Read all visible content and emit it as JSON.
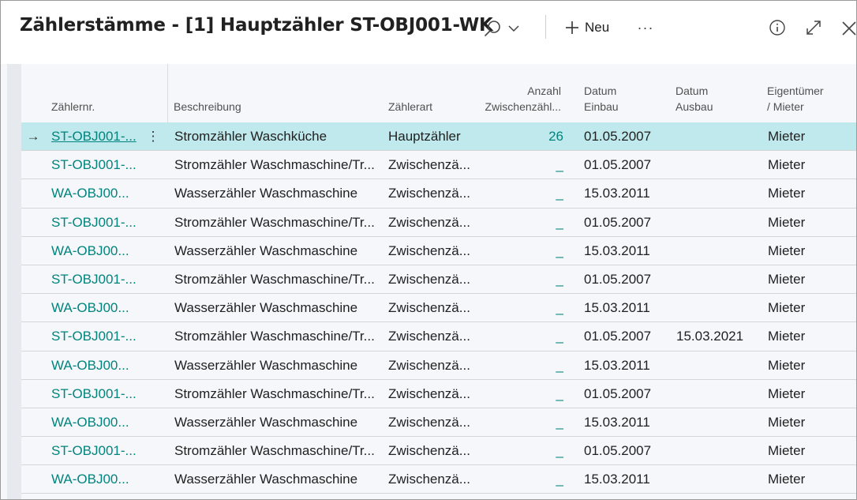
{
  "header": {
    "title": "Zählerstämme - [1] Hauptzähler ST-OBJ001-WK",
    "new_label": "Neu",
    "more_label": "···",
    "icons": {
      "search": "search-icon",
      "chevron": "chevron-down-icon",
      "plus": "plus-icon",
      "info": "info-icon",
      "expand": "expand-icon",
      "close": "close-icon"
    }
  },
  "columns": {
    "nr": "Zählernr.",
    "beschreibung": "Beschreibung",
    "art": "Zählerart",
    "anzahl_1": "Anzahl",
    "anzahl_2": "Zwischenzähl...",
    "einbau_1": "Datum",
    "einbau_2": "Einbau",
    "ausbau_1": "Datum",
    "ausbau_2": "Ausbau",
    "eig_1": "Eigentümer",
    "eig_2": "/ Mieter"
  },
  "selected_arrow": "→",
  "row_menu": "⋮",
  "rows": [
    {
      "nr": "ST-OBJ001-...",
      "beschreibung": "Stromzähler Waschküche",
      "art": "Hauptzähler",
      "anzahl": "26",
      "einbau": "01.05.2007",
      "ausbau": "",
      "eig": "Mieter"
    },
    {
      "nr": "ST-OBJ001-...",
      "beschreibung": "Stromzähler Waschmaschine/Tr...",
      "art": "Zwischenzä...",
      "anzahl": "_",
      "einbau": "01.05.2007",
      "ausbau": "",
      "eig": "Mieter"
    },
    {
      "nr": "WA-OBJ00...",
      "beschreibung": "Wasserzähler Waschmaschine",
      "art": "Zwischenzä...",
      "anzahl": "_",
      "einbau": "15.03.2011",
      "ausbau": "",
      "eig": "Mieter"
    },
    {
      "nr": "ST-OBJ001-...",
      "beschreibung": "Stromzähler Waschmaschine/Tr...",
      "art": "Zwischenzä...",
      "anzahl": "_",
      "einbau": "01.05.2007",
      "ausbau": "",
      "eig": "Mieter"
    },
    {
      "nr": "WA-OBJ00...",
      "beschreibung": "Wasserzähler Waschmaschine",
      "art": "Zwischenzä...",
      "anzahl": "_",
      "einbau": "15.03.2011",
      "ausbau": "",
      "eig": "Mieter"
    },
    {
      "nr": "ST-OBJ001-...",
      "beschreibung": "Stromzähler Waschmaschine/Tr...",
      "art": "Zwischenzä...",
      "anzahl": "_",
      "einbau": "01.05.2007",
      "ausbau": "",
      "eig": "Mieter"
    },
    {
      "nr": "WA-OBJ00...",
      "beschreibung": "Wasserzähler Waschmaschine",
      "art": "Zwischenzä...",
      "anzahl": "_",
      "einbau": "15.03.2011",
      "ausbau": "",
      "eig": "Mieter"
    },
    {
      "nr": "ST-OBJ001-...",
      "beschreibung": "Stromzähler Waschmaschine/Tr...",
      "art": "Zwischenzä...",
      "anzahl": "_",
      "einbau": "01.05.2007",
      "ausbau": "15.03.2021",
      "eig": "Mieter"
    },
    {
      "nr": "WA-OBJ00...",
      "beschreibung": "Wasserzähler Waschmaschine",
      "art": "Zwischenzä...",
      "anzahl": "_",
      "einbau": "15.03.2011",
      "ausbau": "",
      "eig": "Mieter"
    },
    {
      "nr": "ST-OBJ001-...",
      "beschreibung": "Stromzähler Waschmaschine/Tr...",
      "art": "Zwischenzä...",
      "anzahl": "_",
      "einbau": "01.05.2007",
      "ausbau": "",
      "eig": "Mieter"
    },
    {
      "nr": "WA-OBJ00...",
      "beschreibung": "Wasserzähler Waschmaschine",
      "art": "Zwischenzä...",
      "anzahl": "_",
      "einbau": "15.03.2011",
      "ausbau": "",
      "eig": "Mieter"
    },
    {
      "nr": "ST-OBJ001-...",
      "beschreibung": "Stromzähler Waschmaschine/Tr...",
      "art": "Zwischenzä...",
      "anzahl": "_",
      "einbau": "01.05.2007",
      "ausbau": "",
      "eig": "Mieter"
    },
    {
      "nr": "WA-OBJ00...",
      "beschreibung": "Wasserzähler Waschmaschine",
      "art": "Zwischenzä...",
      "anzahl": "_",
      "einbau": "15.03.2011",
      "ausbau": "",
      "eig": "Mieter"
    }
  ],
  "colors": {
    "link": "#00847d",
    "selected_row": "#bfe9ec",
    "content_bg": "#f5f7fa"
  }
}
